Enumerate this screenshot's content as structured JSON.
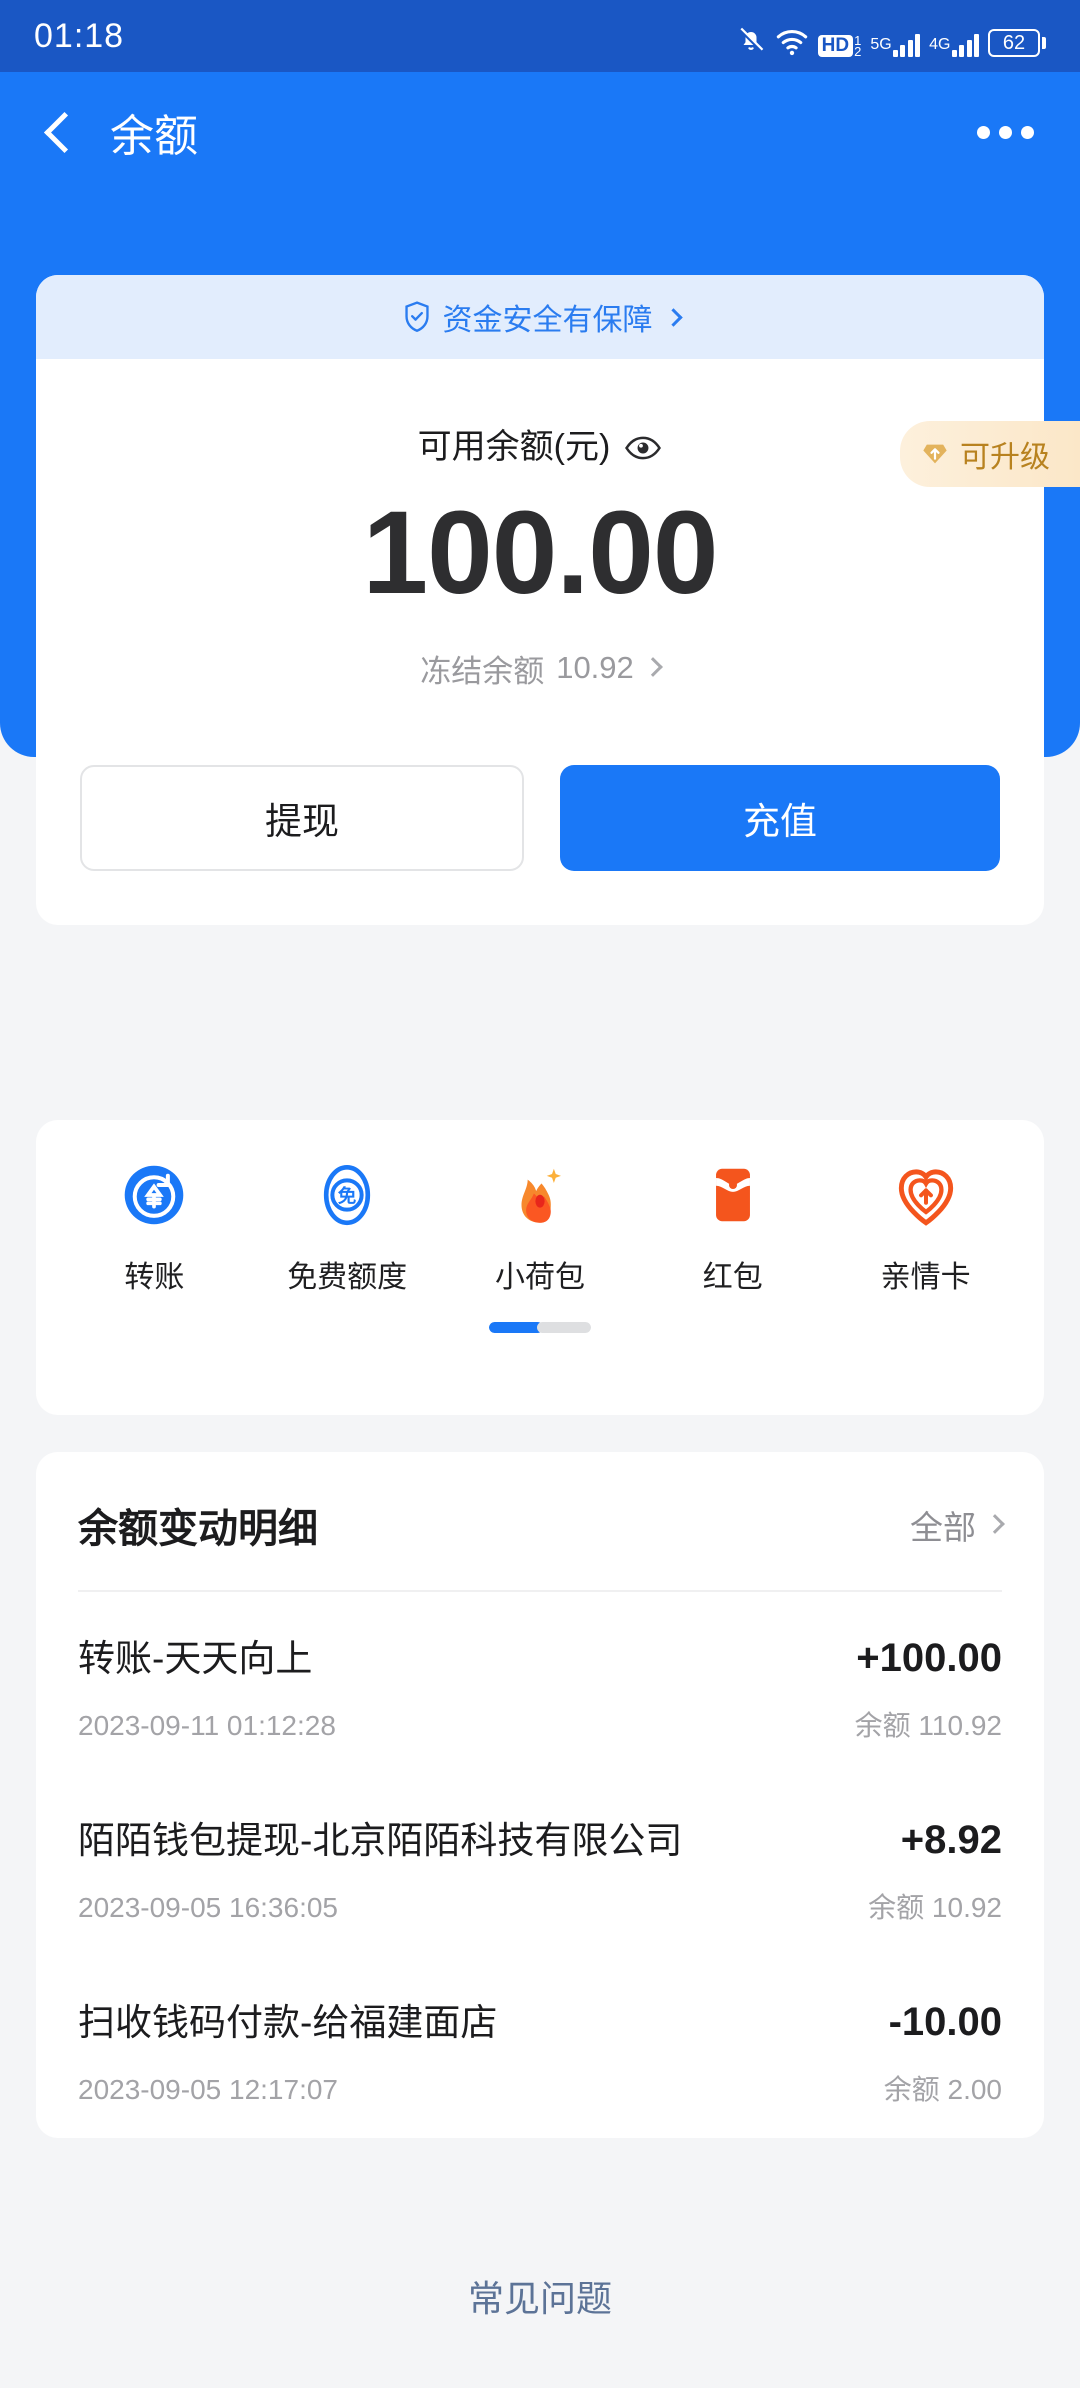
{
  "status_bar": {
    "time": "01:18",
    "mute_icon": "bell-muted-icon",
    "wifi_icon": "wifi-icon",
    "hd_label": "HD",
    "sim1_label": "1",
    "sim2_label": "2",
    "net1_label": "5G",
    "net2_label": "4G",
    "battery_level": "62"
  },
  "nav": {
    "back_icon": "back-chevron-icon",
    "title": "余额",
    "more_icon": "more-dots-icon"
  },
  "balance_card": {
    "safe_banner": {
      "icon": "shield-check-icon",
      "text": "资金安全有保障"
    },
    "available_label": "可用余额(元)",
    "eye_icon": "eye-icon",
    "upgrade_badge": {
      "icon": "gem-upgrade-icon",
      "text": "可升级"
    },
    "amount": "100.00",
    "frozen_label": "冻结余额",
    "frozen_value": "10.92",
    "withdraw_button": "提现",
    "recharge_button": "充值"
  },
  "quick_actions": {
    "items": [
      {
        "label": "转账",
        "icon": "transfer-yuan-icon"
      },
      {
        "label": "免费额度",
        "icon": "free-quota-icon"
      },
      {
        "label": "小荷包",
        "icon": "pocket-flame-icon"
      },
      {
        "label": "红包",
        "icon": "red-packet-icon"
      },
      {
        "label": "亲情卡",
        "icon": "family-card-heart-icon"
      }
    ],
    "pager": {
      "pages": 2,
      "active": 1
    }
  },
  "transactions": {
    "title": "余额变动明细",
    "all_label": "全部",
    "balance_prefix": "余额",
    "rows": [
      {
        "name": "转账-天天向上",
        "amount": "+100.00",
        "time": "2023-09-11 01:12:28",
        "balance": "余额 110.92"
      },
      {
        "name": "陌陌钱包提现-北京陌陌科技有限公司",
        "amount": "+8.92",
        "time": "2023-09-05 16:36:05",
        "balance": "余额 10.92"
      },
      {
        "name": "扫收钱码付款-给福建面店",
        "amount": "-10.00",
        "time": "2023-09-05 12:17:07",
        "balance": "余额 2.00"
      }
    ]
  },
  "footer": {
    "faq_label": "常见问题"
  },
  "colors": {
    "status_bar_blue": "#1a57c4",
    "header_blue": "#1a78f7",
    "accent_blue": "#1a78f7",
    "banner_blue": "#e2edfd",
    "page_bg": "#f4f5f7",
    "badge_gold": "#b8821f",
    "orange": "#f4551d",
    "faq_blue": "#5c7397"
  }
}
